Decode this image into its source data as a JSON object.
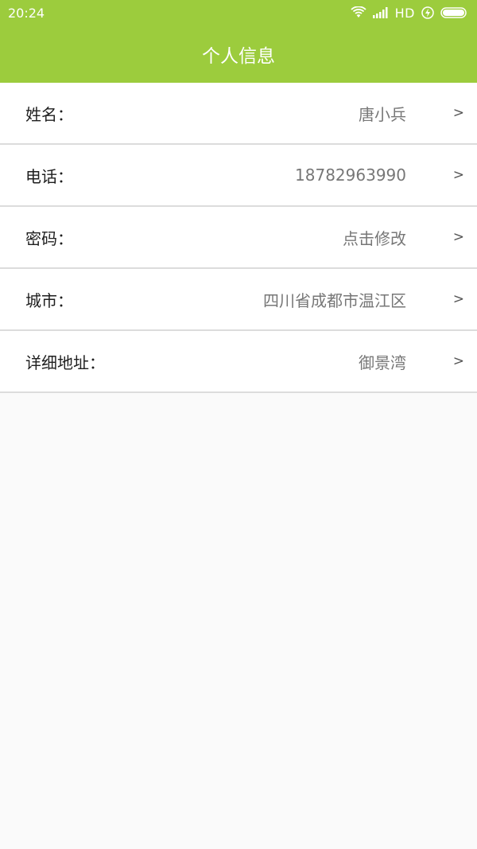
{
  "status_bar": {
    "time": "20:24",
    "network": "HD"
  },
  "header": {
    "title": "个人信息"
  },
  "colors": {
    "accent": "#9ccc3d"
  },
  "rows": [
    {
      "label": "姓名：",
      "value": "唐小兵",
      "arrow": ">"
    },
    {
      "label": "电话：",
      "value": "18782963990",
      "arrow": ">"
    },
    {
      "label": "密码：",
      "value": "点击修改",
      "arrow": ">"
    },
    {
      "label": "城市：",
      "value": "四川省成都市温江区",
      "arrow": ">"
    },
    {
      "label": "详细地址：",
      "value": "御景湾",
      "arrow": ">"
    }
  ]
}
